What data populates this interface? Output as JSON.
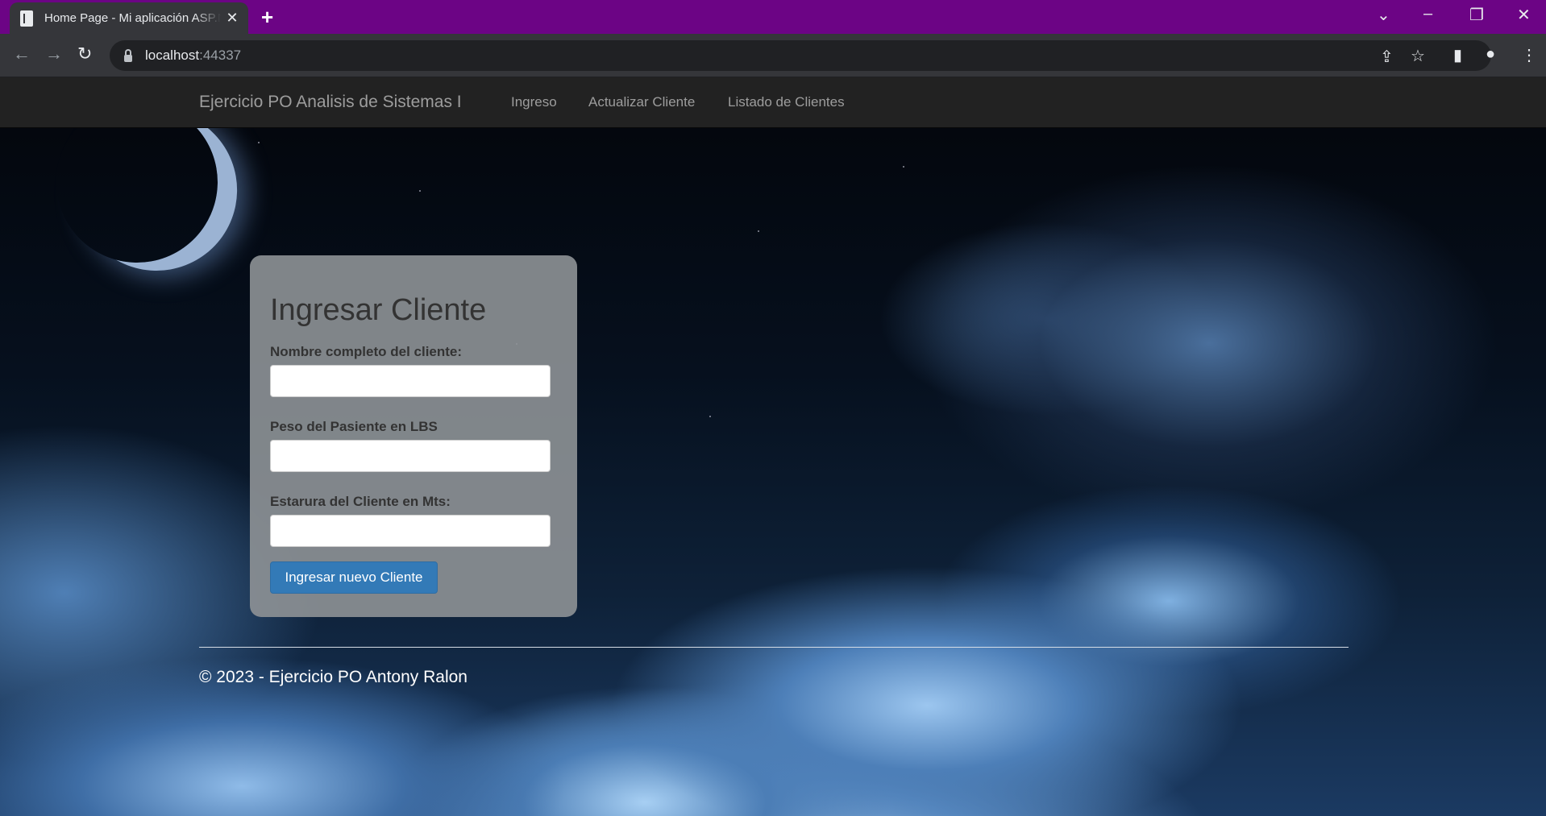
{
  "browser": {
    "tab_title": "Home Page - Mi aplicación ASP.NET",
    "tab_close": "✕",
    "new_tab": "+",
    "url_host": "localhost",
    "url_port": ":44337",
    "window_controls": [
      "⌄",
      "–",
      "❐",
      "✕"
    ],
    "tabstrip_color": "#6c0485"
  },
  "site": {
    "brand": "Ejercicio PO Analisis de Sistemas I",
    "nav": [
      "Ingreso",
      "Actualizar Cliente",
      "Listado de Clientes"
    ]
  },
  "form": {
    "title": "Ingresar Cliente",
    "fields": [
      {
        "label": "Nombre completo del cliente:",
        "value": ""
      },
      {
        "label": "Peso del Pasiente en LBS",
        "value": ""
      },
      {
        "label": "Estarura del Cliente en Mts:",
        "value": ""
      }
    ],
    "submit_label": "Ingresar nuevo Cliente",
    "accent_color": "#337ab7"
  },
  "footer": {
    "text": "© 2023 - Ejercicio PO Antony Ralon"
  }
}
